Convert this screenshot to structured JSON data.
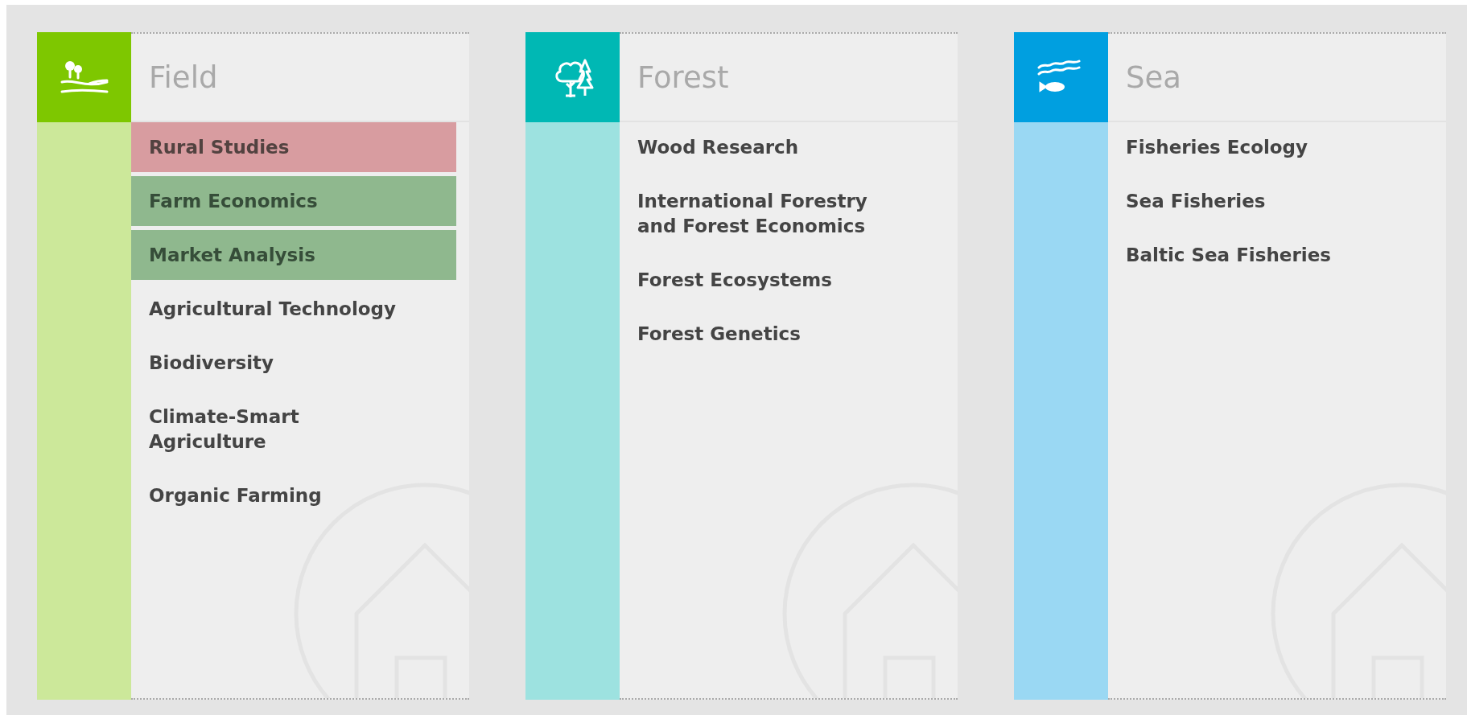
{
  "cards": [
    {
      "title": "Field",
      "kind": "field",
      "items": [
        {
          "label": "Rural Studies",
          "color": "#d89ca0"
        },
        {
          "label": "Farm Economics",
          "color": "#8fb88e"
        },
        {
          "label": "Market Analysis",
          "color": "#8fb88e"
        },
        {
          "label": "Agricultural Technology"
        },
        {
          "label": "Biodiversity"
        },
        {
          "label": "Climate-Smart Agriculture"
        },
        {
          "label": "Organic Farming"
        }
      ]
    },
    {
      "title": "Forest",
      "kind": "forest",
      "items": [
        {
          "label": "Wood Research"
        },
        {
          "label": "International Forestry and Forest Economics"
        },
        {
          "label": "Forest Ecosystems"
        },
        {
          "label": "Forest Genetics"
        }
      ]
    },
    {
      "title": "Sea",
      "kind": "sea",
      "items": [
        {
          "label": "Fisheries Ecology"
        },
        {
          "label": "Sea Fisheries"
        },
        {
          "label": "Baltic Sea Fisheries"
        }
      ]
    }
  ]
}
